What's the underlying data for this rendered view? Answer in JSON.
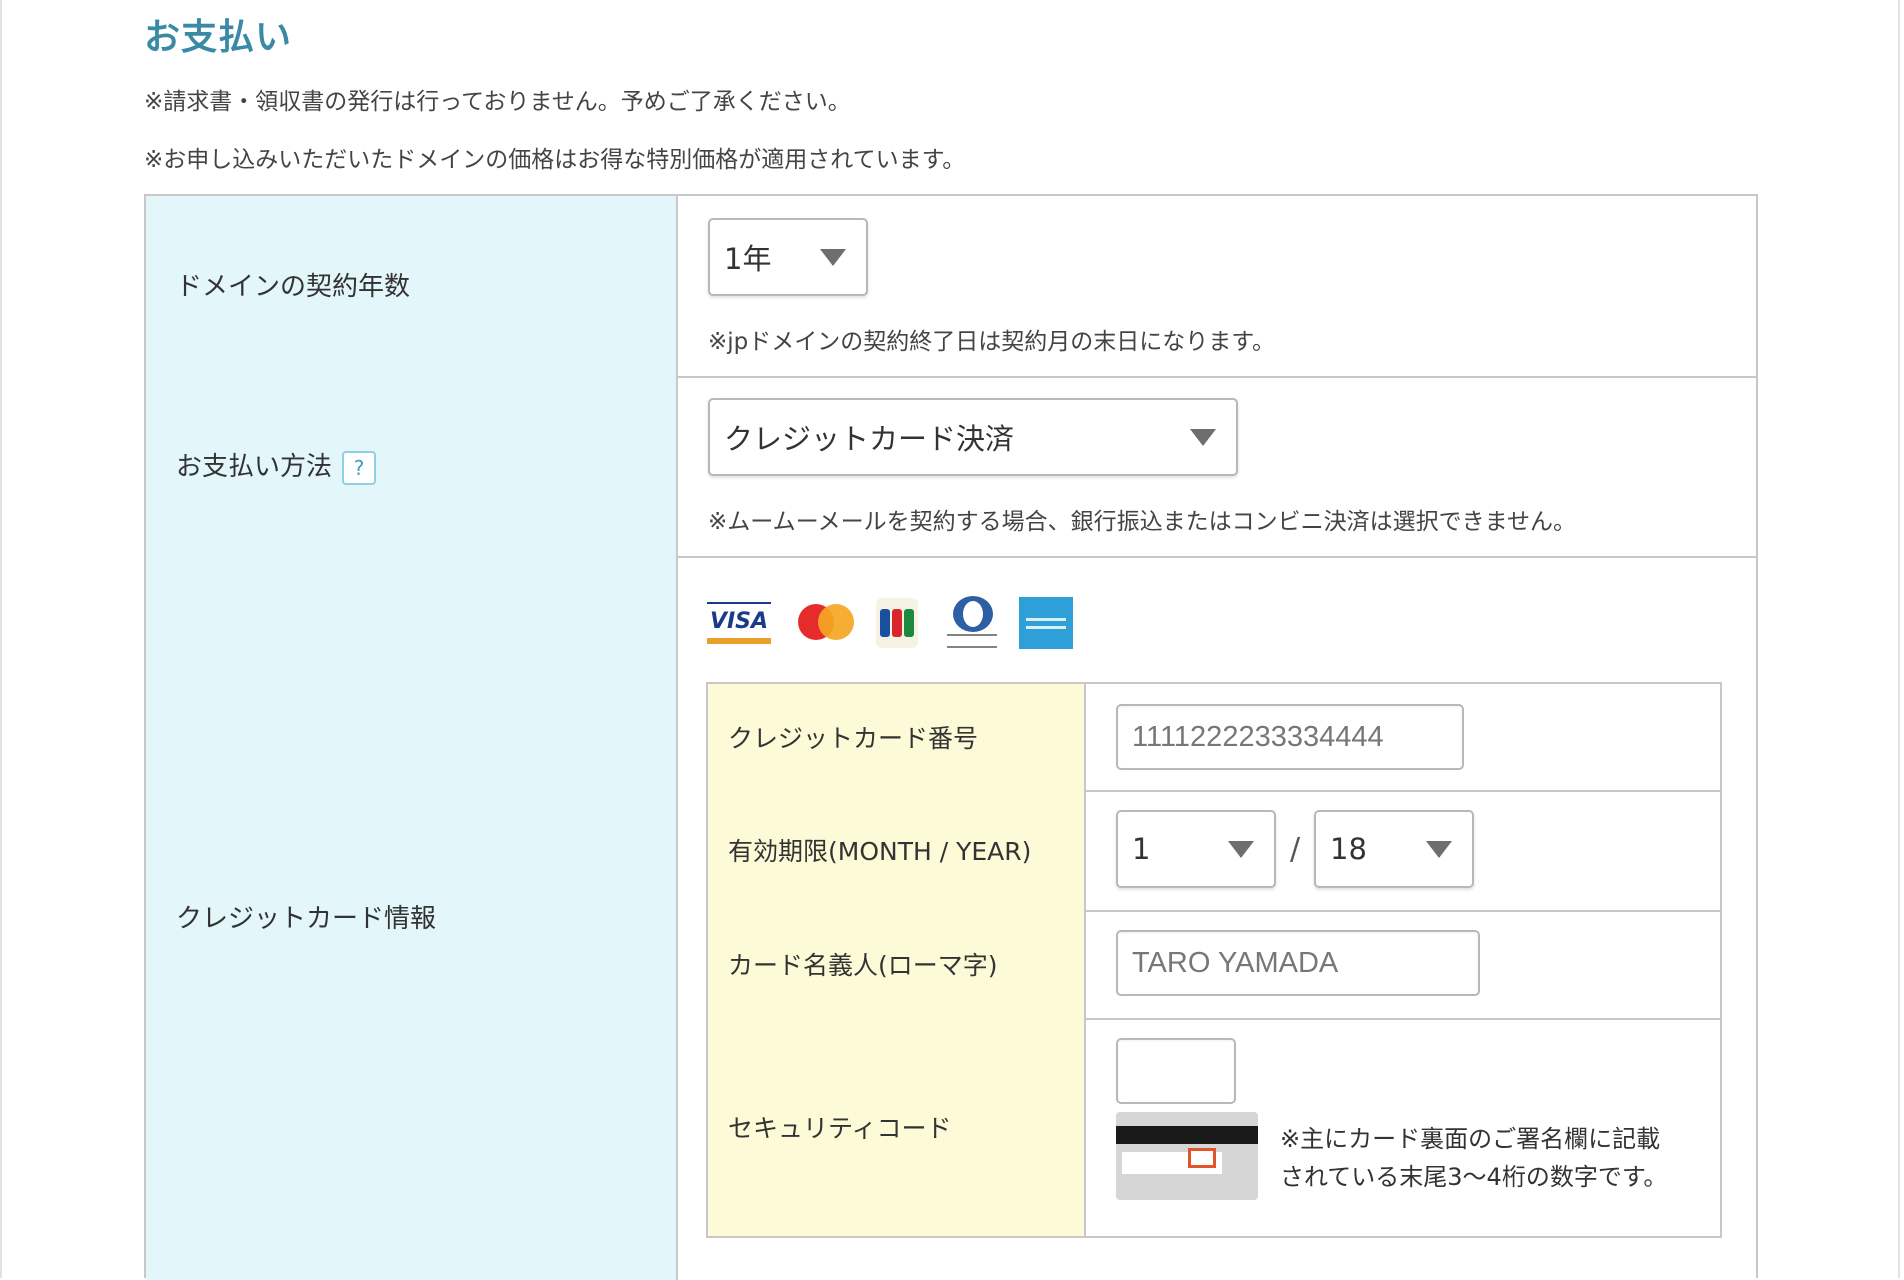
{
  "section_title": "お支払い",
  "notes": [
    "※請求書・領収書の発行は行っておりません。予めご了承ください。",
    "※お申し込みいただいたドメインの価格はお得な特別価格が適用されています。"
  ],
  "contract_years": {
    "label": "ドメインの契約年数",
    "selected": "1年",
    "note": "※jpドメインの契約終了日は契約月の末日になります。"
  },
  "payment_method": {
    "label": "お支払い方法",
    "help": "?",
    "selected": "クレジットカード決済",
    "note": "※ムームーメールを契約する場合、銀行振込またはコンビニ決済は選択できません。"
  },
  "card_info": {
    "label": "クレジットカード情報",
    "logos": [
      {
        "name": "visa",
        "text": "VISA"
      },
      {
        "name": "mastercard"
      },
      {
        "name": "jcb"
      },
      {
        "name": "diners"
      },
      {
        "name": "amex"
      }
    ],
    "number": {
      "label": "クレジットカード番号",
      "placeholder": "1111222233334444"
    },
    "expiry": {
      "label": "有効期限(MONTH / YEAR)",
      "month": "1",
      "separator": "/",
      "year": "18"
    },
    "holder": {
      "label": "カード名義人(ローマ字)",
      "placeholder": "TARO YAMADA"
    },
    "security": {
      "label": "セキュリティコード",
      "value": "",
      "note_line1": "※主にカード裏面のご署名欄に記載",
      "note_line2": "されている末尾3〜4桁の数字です。"
    }
  },
  "colors": {
    "title": "#3a8aa6",
    "label_bg": "#e3f6fa",
    "inner_label_bg": "#fdfbd7",
    "border": "#c8c8c8"
  }
}
